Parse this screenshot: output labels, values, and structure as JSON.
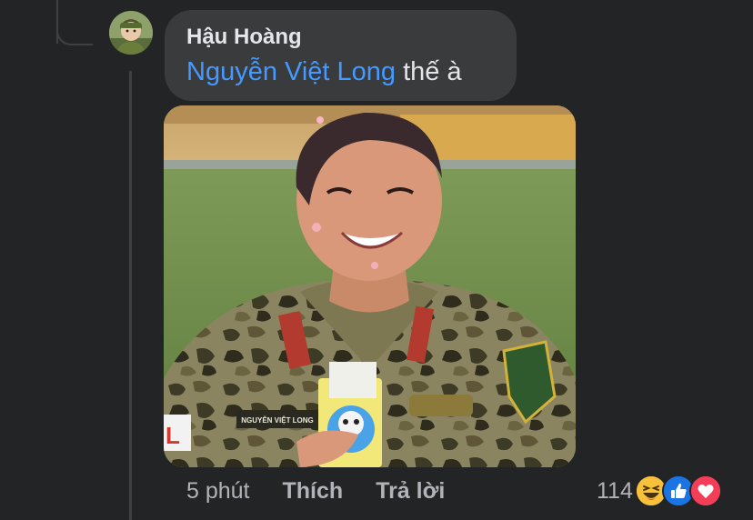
{
  "comment": {
    "author": "Hậu Hoàng",
    "mention": "Nguyễn Việt Long",
    "text": " thế à",
    "timestamp": "5 phút",
    "like_label": "Thích",
    "reply_label": "Trả lời",
    "reaction_count": "114",
    "reactions": [
      "haha-icon",
      "like-icon",
      "love-icon"
    ],
    "attachment": {
      "name_tape": "NGUYỄN VIỆT LONG"
    }
  },
  "colors": {
    "background": "#232425",
    "bubble": "#3a3b3c",
    "mention": "#4599ff",
    "text_primary": "#e4e6eb",
    "text_secondary": "#b0b3b8"
  }
}
